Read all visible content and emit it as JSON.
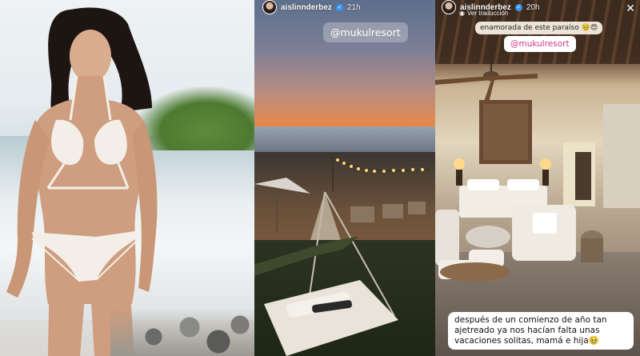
{
  "panels": [
    {
      "type": "photo",
      "subject": "woman in white crochet swimsuit on beach"
    },
    {
      "type": "story",
      "username": "aislinnderbez",
      "time": "21h",
      "mention": "@mukulresort"
    },
    {
      "type": "story",
      "username": "aislinnderbez",
      "time": "20h",
      "translate_label": "Ver traducción",
      "caption_top": "enamorada de este paraíso 🥹😍",
      "mention": "@mukulresort",
      "caption_bottom": "después de un comienzo de año tan ajetreado ya nos hacían falta unas vacaciones solitas, mamá e hija🥹"
    }
  ],
  "icons": {
    "verified": "verified-badge-icon",
    "globe": "globe-icon",
    "close": "close-icon"
  },
  "colors": {
    "verified": "#3897f0",
    "mention_text": "#d13a8a"
  }
}
